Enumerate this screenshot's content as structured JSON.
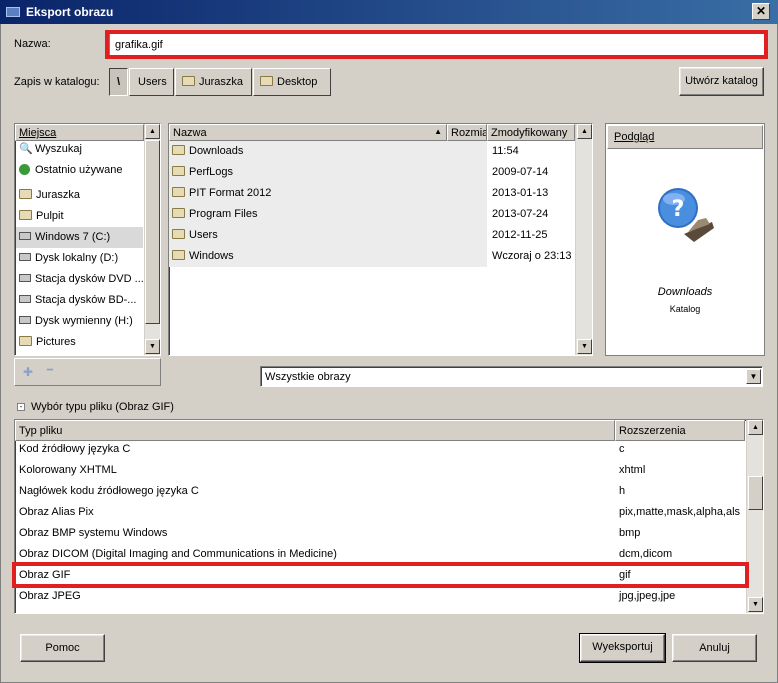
{
  "window": {
    "title": "Eksport obrazu",
    "close_label": "✕"
  },
  "name_field": {
    "label": "Nazwa:",
    "value": "grafika.gif"
  },
  "save_in": {
    "label": "Zapis w katalogu:",
    "crumbs": [
      "\\",
      "Users",
      "Juraszka",
      "Desktop"
    ],
    "create_folder_label": "Utwórz katalog"
  },
  "places": {
    "header": "Miejsca",
    "items": [
      {
        "label": "Wyszukaj",
        "icon": "search-icon"
      },
      {
        "label": "Ostatnio używane",
        "icon": "recent-icon"
      },
      {
        "label": "Juraszka",
        "icon": "folder-icon"
      },
      {
        "label": "Pulpit",
        "icon": "folder-icon"
      },
      {
        "label": "Windows 7 (C:)",
        "icon": "drive-icon"
      },
      {
        "label": "Dysk lokalny (D:)",
        "icon": "drive-icon"
      },
      {
        "label": "Stacja dysków DVD ...",
        "icon": "drive-icon"
      },
      {
        "label": "Stacja dysków BD-...",
        "icon": "drive-icon"
      },
      {
        "label": "Dysk wymienny (H:)",
        "icon": "drive-icon"
      },
      {
        "label": "Pictures",
        "icon": "folder-icon"
      }
    ],
    "add_symbol": "✚",
    "remove_symbol": "━"
  },
  "files": {
    "columns": {
      "name": "Nazwa",
      "size": "Rozmiar",
      "modified": "Zmodyfikowany"
    },
    "rows": [
      {
        "name": "Downloads",
        "modified": "11:54"
      },
      {
        "name": "PerfLogs",
        "modified": "2009-07-14"
      },
      {
        "name": "PIT Format 2012",
        "modified": "2013-01-13"
      },
      {
        "name": "Program Files",
        "modified": "2013-07-24"
      },
      {
        "name": "Users",
        "modified": "2012-11-25"
      },
      {
        "name": "Windows",
        "modified": "Wczoraj o 23:13"
      }
    ]
  },
  "preview": {
    "header": "Podgląd",
    "name": "Downloads",
    "type": "Katalog"
  },
  "filter": {
    "value": "Wszystkie obrazy"
  },
  "file_type": {
    "expander_label": "Wybór typu pliku (Obraz GIF)",
    "columns": {
      "type": "Typ pliku",
      "ext": "Rozszerzenia"
    },
    "rows": [
      {
        "type": "Kod źródłowy języka C",
        "ext": "c"
      },
      {
        "type": "Kolorowany XHTML",
        "ext": "xhtml"
      },
      {
        "type": "Nagłówek kodu źródłowego języka C",
        "ext": "h"
      },
      {
        "type": "Obraz Alias Pix",
        "ext": "pix,matte,mask,alpha,als"
      },
      {
        "type": "Obraz BMP systemu Windows",
        "ext": "bmp"
      },
      {
        "type": "Obraz DICOM (Digital Imaging and Communications in Medicine)",
        "ext": "dcm,dicom"
      },
      {
        "type": "Obraz GIF",
        "ext": "gif"
      },
      {
        "type": "Obraz JPEG",
        "ext": "jpg,jpeg,jpe"
      }
    ]
  },
  "buttons": {
    "help": "Pomoc",
    "export": "Wyeksportuj",
    "cancel": "Anuluj"
  },
  "colors": {
    "highlight": "#e02020",
    "title_bar": "#0a246a",
    "selected_place": "#d9d9d9"
  }
}
